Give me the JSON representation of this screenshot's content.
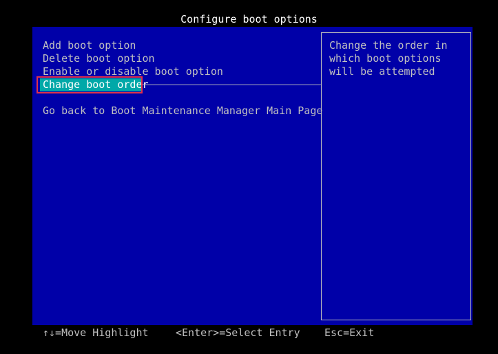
{
  "title": "Configure boot options",
  "menu": {
    "items": [
      {
        "label": "Add boot option"
      },
      {
        "label": "Delete boot option"
      },
      {
        "label": "Enable or disable boot option"
      },
      {
        "label": "Change boot order"
      },
      {
        "label": "Go back to Boot Maintenance Manager Main Page"
      }
    ],
    "selected_index": 3
  },
  "help": {
    "text": "Change the order in which boot options will be attempted"
  },
  "footer": {
    "move": "↑↓=Move Highlight",
    "select": "<Enter>=Select Entry",
    "exit": "Esc=Exit"
  },
  "colors": {
    "background": "#000000",
    "panel": "#0000a8",
    "text": "#c0c0c0",
    "title": "#ffffff",
    "selection": "#00a8a8",
    "highlight_box": "#e0304a"
  }
}
